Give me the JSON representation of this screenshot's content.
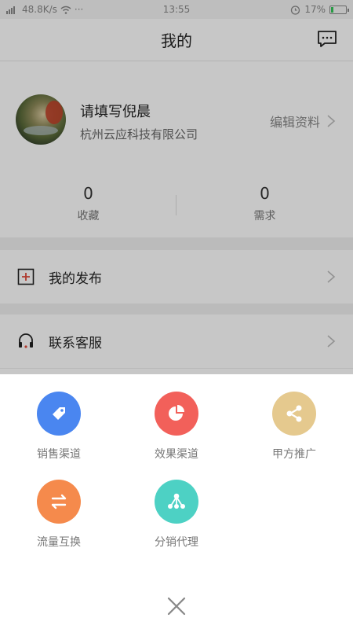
{
  "status_bar": {
    "network_speed": "48.8K/s",
    "time": "13:55",
    "battery_percent": "17%",
    "battery_level": 0.17
  },
  "nav": {
    "title": "我的"
  },
  "profile": {
    "name": "请填写倪晨",
    "company": "杭州云应科技有限公司",
    "edit_label": "编辑资料",
    "stats": [
      {
        "value": "0",
        "label": "收藏"
      },
      {
        "value": "0",
        "label": "需求"
      }
    ]
  },
  "menu": [
    {
      "label": "我的发布",
      "icon": "plus-square-icon"
    },
    {
      "label": "联系客服",
      "icon": "headset-icon"
    }
  ],
  "sheet": {
    "items": [
      {
        "label": "销售渠道",
        "color": "#4a86f0",
        "icon": "tag-icon"
      },
      {
        "label": "效果渠道",
        "color": "#f2605a",
        "icon": "pie-chart-icon"
      },
      {
        "label": "甲方推广",
        "color": "#e5c98e",
        "icon": "share-icon"
      },
      {
        "label": "流量互换",
        "color": "#f58a4c",
        "icon": "swap-arrows-icon"
      },
      {
        "label": "分销代理",
        "color": "#4dd1c4",
        "icon": "network-icon"
      }
    ]
  },
  "colors": {
    "accent_red": "#e04a3a"
  }
}
